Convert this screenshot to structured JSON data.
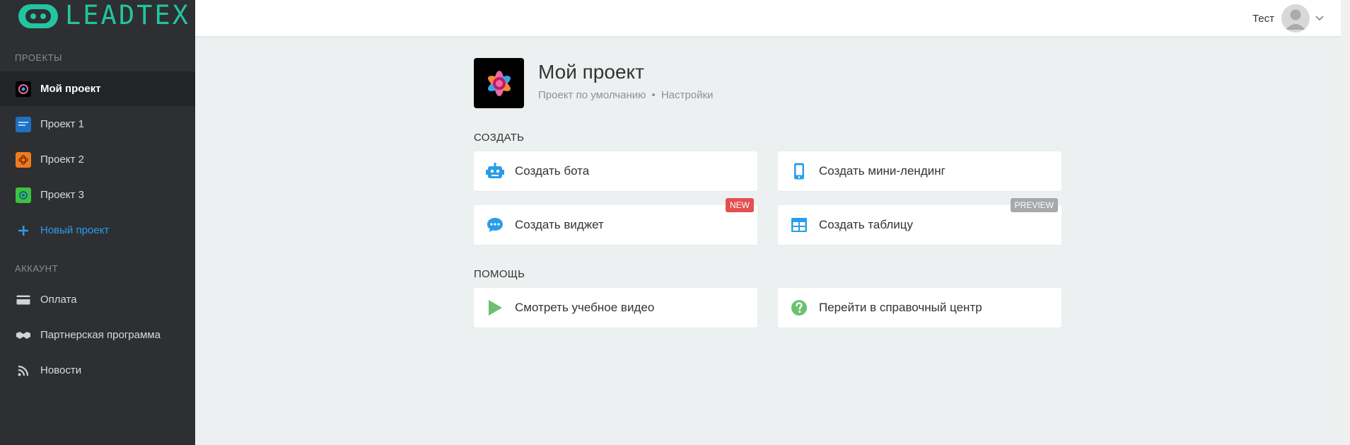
{
  "app": {
    "brand": "LEADTEX",
    "brand_color": "#22c5a0"
  },
  "sidebar": {
    "projects_label": "ПРОЕКТЫ",
    "projects": [
      {
        "label": "Мой проект",
        "active": true
      },
      {
        "label": "Проект 1"
      },
      {
        "label": "Проект 2"
      },
      {
        "label": "Проект 3"
      }
    ],
    "new_project": "Новый проект",
    "account_label": "АККАУНТ",
    "account": [
      {
        "label": "Оплата",
        "icon": "credit-card-icon"
      },
      {
        "label": "Партнерская программа",
        "icon": "handshake-icon"
      },
      {
        "label": "Новости",
        "icon": "rss-icon"
      }
    ]
  },
  "header": {
    "user_name": "Тест"
  },
  "project": {
    "title": "Мой проект",
    "subtitle": "Проект по умолчанию",
    "separator": "•",
    "settings_link": "Настройки"
  },
  "create": {
    "label": "СОЗДАТЬ",
    "cards": [
      {
        "label": "Создать бота",
        "icon": "robot-icon"
      },
      {
        "label": "Создать мини-лендинг",
        "icon": "phone-icon"
      },
      {
        "label": "Создать виджет",
        "icon": "chat-icon",
        "badge": "NEW"
      },
      {
        "label": "Создать таблицу",
        "icon": "table-icon",
        "badge": "PREVIEW"
      }
    ]
  },
  "help": {
    "label": "ПОМОЩЬ",
    "cards": [
      {
        "label": "Смотреть учебное видео",
        "icon": "play-icon"
      },
      {
        "label": "Перейти в справочный центр",
        "icon": "help-icon"
      }
    ]
  },
  "colors": {
    "sidebar_bg": "#2d2f33",
    "accent_blue": "#2a9de8",
    "green": "#6cc070",
    "badge_new": "#e25050",
    "badge_preview": "#a6a8aa"
  }
}
